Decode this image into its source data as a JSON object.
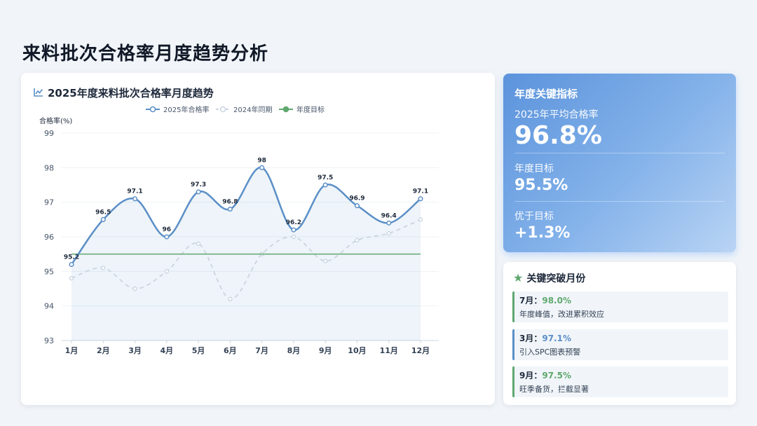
{
  "page_title": "来料批次合格率月度趋势分析",
  "chart_card": {
    "title": "2025年度来料批次合格率月度趋势"
  },
  "kpi": {
    "heading": "年度关键指标",
    "avg_label": "2025年平均合格率",
    "avg_value": "96.8%",
    "target_label": "年度目标",
    "target_value": "95.5%",
    "over_label": "优于目标",
    "over_value": "+1.3%"
  },
  "breakthrough": {
    "title": "关键突破月份",
    "items": [
      {
        "month": "7月：",
        "value": "98.0%",
        "desc": "年度峰值，改进累积效应"
      },
      {
        "month": "3月：",
        "value": "97.1%",
        "desc": "引入SPC图表预警"
      },
      {
        "month": "9月：",
        "value": "97.5%",
        "desc": "旺季备货，拦截显著"
      }
    ]
  },
  "colors": {
    "series_2025": "#5b8fc7",
    "series_2024": "#cbd5e1",
    "target": "#5fa86f",
    "kpi_bg": "#6ea2e3"
  },
  "icons": {
    "chart": "line-chart-icon",
    "star": "star-icon"
  },
  "chart_data": {
    "type": "line",
    "categories": [
      "1月",
      "2月",
      "3月",
      "4月",
      "5月",
      "6月",
      "7月",
      "8月",
      "9月",
      "10月",
      "11月",
      "12月"
    ],
    "series": [
      {
        "name": "2025年合格率",
        "values": [
          95.2,
          96.5,
          97.1,
          96,
          97.3,
          96.8,
          98,
          96.2,
          97.5,
          96.9,
          96.4,
          97.1
        ],
        "style": "solid-area",
        "labels": true
      },
      {
        "name": "2024年同期",
        "values": [
          94.8,
          95.1,
          94.5,
          95.0,
          95.8,
          94.2,
          95.5,
          96.0,
          95.3,
          95.9,
          96.1,
          96.5
        ],
        "style": "dashed"
      },
      {
        "name": "年度目标",
        "values": [
          95.5,
          95.5,
          95.5,
          95.5,
          95.5,
          95.5,
          95.5,
          95.5,
          95.5,
          95.5,
          95.5,
          95.5
        ],
        "style": "flat"
      }
    ],
    "ylabel": "合格率(%)",
    "ylim": [
      93,
      99
    ],
    "yticks": [
      93,
      94,
      95,
      96,
      97,
      98,
      99
    ],
    "grid": true,
    "legend": "top-center"
  }
}
